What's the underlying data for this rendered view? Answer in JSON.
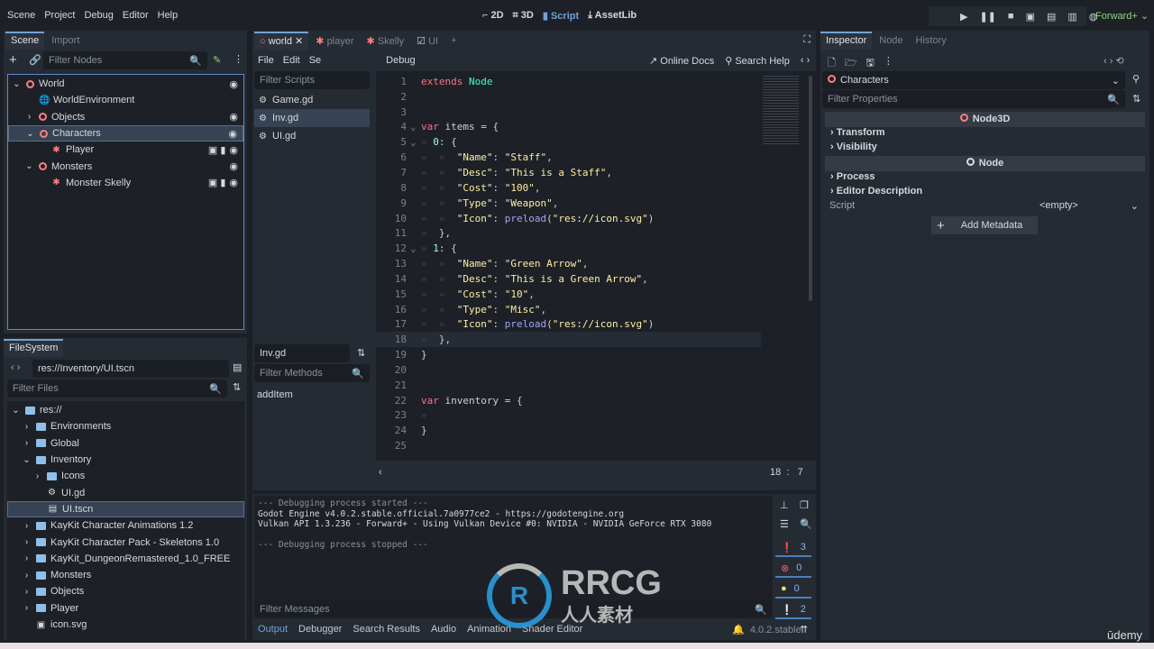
{
  "menu": [
    "Scene",
    "Project",
    "Debug",
    "Editor",
    "Help"
  ],
  "workspaces": [
    {
      "icon": "2d-icon",
      "label": "2D"
    },
    {
      "icon": "3d-icon",
      "label": "3D"
    },
    {
      "icon": "script-icon",
      "label": "Script"
    },
    {
      "icon": "assetlib-icon",
      "label": "AssetLib"
    }
  ],
  "renderer": "Forward+",
  "scene_dock": {
    "tabs": [
      "Scene",
      "Import"
    ],
    "filter_placeholder": "Filter Nodes",
    "tree": [
      {
        "label": "World",
        "depth": 0,
        "icon": "node3d",
        "expanded": true,
        "eye": true
      },
      {
        "label": "WorldEnvironment",
        "depth": 1,
        "icon": "world-environment"
      },
      {
        "label": "Objects",
        "depth": 1,
        "icon": "node3d",
        "collapsed": true,
        "eye": true
      },
      {
        "label": "Characters",
        "depth": 1,
        "icon": "node3d",
        "expanded": true,
        "eye": true,
        "selected": true
      },
      {
        "label": "Player",
        "depth": 2,
        "icon": "character",
        "eye": true,
        "extra": true
      },
      {
        "label": "Monsters",
        "depth": 1,
        "icon": "node3d",
        "expanded": true,
        "eye": true
      },
      {
        "label": "Monster Skelly",
        "depth": 2,
        "icon": "character",
        "eye": true,
        "extra": true
      }
    ]
  },
  "filesystem": {
    "tab": "FileSystem",
    "path": "res://Inventory/UI.tscn",
    "filter_placeholder": "Filter Files",
    "tree": [
      {
        "label": "res://",
        "depth": 0,
        "type": "folder",
        "arrow": "v"
      },
      {
        "label": "Environments",
        "depth": 1,
        "type": "folder",
        "arrow": ">"
      },
      {
        "label": "Global",
        "depth": 1,
        "type": "folder",
        "arrow": ">"
      },
      {
        "label": "Inventory",
        "depth": 1,
        "type": "folder",
        "arrow": "v"
      },
      {
        "label": "Icons",
        "depth": 2,
        "type": "folder",
        "arrow": ">"
      },
      {
        "label": "UI.gd",
        "depth": 2,
        "type": "script"
      },
      {
        "label": "UI.tscn",
        "depth": 2,
        "type": "scene",
        "selected": true
      },
      {
        "label": "KayKit Character Animations 1.2",
        "depth": 1,
        "type": "folder",
        "arrow": ">"
      },
      {
        "label": "KayKit Character Pack - Skeletons 1.0",
        "depth": 1,
        "type": "folder",
        "arrow": ">"
      },
      {
        "label": "KayKit_DungeonRemastered_1.0_FREE",
        "depth": 1,
        "type": "folder",
        "arrow": ">"
      },
      {
        "label": "Monsters",
        "depth": 1,
        "type": "folder",
        "arrow": ">"
      },
      {
        "label": "Objects",
        "depth": 1,
        "type": "folder",
        "arrow": ">"
      },
      {
        "label": "Player",
        "depth": 1,
        "type": "folder",
        "arrow": ">"
      },
      {
        "label": "icon.svg",
        "depth": 1,
        "type": "image"
      }
    ]
  },
  "scene_tabs": [
    {
      "label": "world",
      "active": true
    },
    {
      "label": "player"
    },
    {
      "label": "Skelly"
    },
    {
      "label": "UI"
    }
  ],
  "script_menu": [
    "File",
    "Edit",
    "Se",
    "Debug"
  ],
  "online_docs": "Online Docs",
  "search_help": "Search Help",
  "scripts": {
    "filter_placeholder": "Filter Scripts",
    "items": [
      "Game.gd",
      "Inv.gd",
      "UI.gd"
    ],
    "selected": 1,
    "current": "Inv.gd",
    "methods_placeholder": "Filter Methods",
    "methods": [
      "addItem"
    ]
  },
  "code": [
    [
      [
        "kw",
        "extends "
      ],
      [
        "cls",
        "Node"
      ]
    ],
    [],
    [],
    [
      [
        "kw",
        "var "
      ],
      [
        "txt",
        "items = {"
      ]
    ],
    [
      [
        "ind",
        "» "
      ],
      [
        "num",
        "0"
      ],
      [
        "txt",
        ": {"
      ]
    ],
    [
      [
        "ind",
        "»  »  "
      ],
      [
        "str",
        "\"Name\""
      ],
      [
        "txt",
        ": "
      ],
      [
        "str",
        "\"Staff\""
      ],
      [
        "txt",
        ","
      ]
    ],
    [
      [
        "ind",
        "»  »  "
      ],
      [
        "str",
        "\"Desc\""
      ],
      [
        "txt",
        ": "
      ],
      [
        "str",
        "\"This is a Staff\""
      ],
      [
        "txt",
        ","
      ]
    ],
    [
      [
        "ind",
        "»  »  "
      ],
      [
        "str",
        "\"Cost\""
      ],
      [
        "txt",
        ": "
      ],
      [
        "str",
        "\"100\""
      ],
      [
        "txt",
        ","
      ]
    ],
    [
      [
        "ind",
        "»  »  "
      ],
      [
        "str",
        "\"Type\""
      ],
      [
        "txt",
        ": "
      ],
      [
        "str",
        "\"Weapon\""
      ],
      [
        "txt",
        ","
      ]
    ],
    [
      [
        "ind",
        "»  »  "
      ],
      [
        "str",
        "\"Icon\""
      ],
      [
        "txt",
        ": "
      ],
      [
        "fn",
        "preload"
      ],
      [
        "txt",
        "("
      ],
      [
        "str",
        "\"res://icon.svg\""
      ],
      [
        "txt",
        ")"
      ]
    ],
    [
      [
        "ind",
        "»  "
      ],
      [
        "txt",
        "},"
      ]
    ],
    [
      [
        "ind",
        "» "
      ],
      [
        "num",
        "1"
      ],
      [
        "txt",
        ": {"
      ]
    ],
    [
      [
        "ind",
        "»  »  "
      ],
      [
        "str",
        "\"Name\""
      ],
      [
        "txt",
        ": "
      ],
      [
        "str",
        "\"Green Arrow\""
      ],
      [
        "txt",
        ","
      ]
    ],
    [
      [
        "ind",
        "»  »  "
      ],
      [
        "str",
        "\"Desc\""
      ],
      [
        "txt",
        ": "
      ],
      [
        "str",
        "\"This is a Green Arrow\""
      ],
      [
        "txt",
        ","
      ]
    ],
    [
      [
        "ind",
        "»  »  "
      ],
      [
        "str",
        "\"Cost\""
      ],
      [
        "txt",
        ": "
      ],
      [
        "str",
        "\"10\""
      ],
      [
        "txt",
        ","
      ]
    ],
    [
      [
        "ind",
        "»  »  "
      ],
      [
        "str",
        "\"Type\""
      ],
      [
        "txt",
        ": "
      ],
      [
        "str",
        "\"Misc\""
      ],
      [
        "txt",
        ","
      ]
    ],
    [
      [
        "ind",
        "»  »  "
      ],
      [
        "str",
        "\"Icon\""
      ],
      [
        "txt",
        ": "
      ],
      [
        "fn",
        "preload"
      ],
      [
        "txt",
        "("
      ],
      [
        "str",
        "\"res://icon.svg\""
      ],
      [
        "txt",
        ")"
      ]
    ],
    [
      [
        "ind",
        "»  "
      ],
      [
        "txt",
        "},"
      ]
    ],
    [
      [
        "txt",
        "}"
      ]
    ],
    [],
    [],
    [
      [
        "kw",
        "var "
      ],
      [
        "txt",
        "inventory = {"
      ]
    ],
    [
      [
        "ind",
        "» "
      ]
    ],
    [
      [
        "txt",
        "}"
      ]
    ],
    []
  ],
  "fold_lines": [
    4,
    5,
    12
  ],
  "current_line": 18,
  "cursor": {
    "line": "18",
    "col": "7"
  },
  "output": {
    "lines": [
      "--- Debugging process started ---",
      "Godot Engine v4.0.2.stable.official.7a0977ce2 - https://godotengine.org",
      "Vulkan API 1.3.236 - Forward+ - Using Vulkan Device #0: NVIDIA - NVIDIA GeForce RTX 3080",
      "",
      "--- Debugging process stopped ---"
    ],
    "filter_placeholder": "Filter Messages",
    "counts": {
      "messages": "3",
      "errors": "0",
      "warnings": "0",
      "editor": "2"
    }
  },
  "bottom_tabs": [
    "Output",
    "Debugger",
    "Search Results",
    "Audio",
    "Animation",
    "Shader Editor"
  ],
  "version": "4.0.2.stable",
  "inspector": {
    "tabs": [
      "Inspector",
      "Node",
      "History"
    ],
    "object": "Characters",
    "filter_placeholder": "Filter Properties",
    "sections": [
      {
        "title": "Node3D",
        "props": [
          "Transform",
          "Visibility"
        ]
      },
      {
        "title": "Node",
        "props": [
          "Process",
          "Editor Description"
        ]
      }
    ],
    "script_label": "Script",
    "script_value": "<empty>",
    "add_metadata": "Add Metadata"
  },
  "watermark": {
    "brand": "RRCG",
    "sub": "人人素材"
  },
  "udemy": "ūdemy",
  "colors": {
    "accent": "#6fa2d8",
    "node3d": "#fc7f7f",
    "string": "#ffeda1",
    "keyword": "#ff7085"
  }
}
